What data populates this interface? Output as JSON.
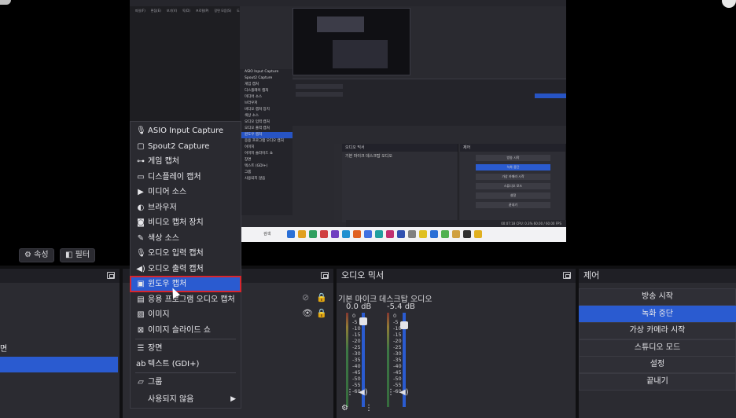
{
  "preview": {
    "menubar": [
      "파일(F)",
      "편집(E)",
      "보기(V)",
      "독(D)",
      "프로필(P)",
      "장면 모음(S)",
      "도구(T)",
      "도움말(H)"
    ],
    "inner_menu_items": [
      "ASIO Input Capture",
      "Spout2 Capture",
      "게임 캡처",
      "디스플레이 캡처",
      "미디어 소스",
      "브라우저",
      "비디오 캡처 장치",
      "색상 소스",
      "오디오 입력 캡처",
      "오디오 출력 캡처",
      "윈도우 캡처",
      "응용 프로그램 오디오 캡처",
      "이미지",
      "이미지 슬라이드 쇼",
      "장면",
      "텍스트 (GDI+)",
      "그룹",
      "사용되지 않음"
    ],
    "inner_mixer_title": "오디오 믹서",
    "inner_mixer_sources": "기본 마이크  데스크탑 오디오",
    "inner_controls_title": "제어",
    "inner_controls": [
      "방송 시작",
      "녹화 중단",
      "가상 카메라 시작",
      "스튜디오 모드",
      "설정",
      "끝내기"
    ],
    "status_text": "00:07:18   CPU: 0.3%   60.00 / 60.00 FPS",
    "taskbar_search": "검색"
  },
  "toolbar": {
    "properties_label": "속성",
    "filters_label": "필터"
  },
  "scenes": {
    "item_prefix": "면"
  },
  "mixer": {
    "title": "오디오 믹서",
    "channels": [
      {
        "name": "기본 마이크",
        "db": "0.0 dB",
        "level": 0.95
      },
      {
        "name": "데스크탑 오디오",
        "db": "-5.4 dB",
        "level": 0.9
      }
    ],
    "scale": [
      "0",
      "-5",
      "-10",
      "-15",
      "-20",
      "-25",
      "-30",
      "-35",
      "-40",
      "-45",
      "-50",
      "-55",
      "-60"
    ]
  },
  "controls": {
    "title": "제어",
    "buttons": [
      "방송 시작",
      "녹화 중단",
      "가상 카메라 시작",
      "스튜디오 모드",
      "설정",
      "끝내기"
    ],
    "active_index": 1
  },
  "context_menu": {
    "items": [
      {
        "icon": "🎙",
        "label": "ASIO Input Capture"
      },
      {
        "icon": "▢",
        "label": "Spout2 Capture"
      },
      {
        "icon": "⊶",
        "label": "게임 캡처"
      },
      {
        "icon": "▭",
        "label": "디스플레이 캡처"
      },
      {
        "icon": "▶",
        "label": "미디어 소스"
      },
      {
        "icon": "◐",
        "label": "브라우저"
      },
      {
        "icon": "◙",
        "label": "비디오 캡처 장치"
      },
      {
        "icon": "✎",
        "label": "색상 소스"
      },
      {
        "icon": "🎙",
        "label": "오디오 입력 캡처"
      },
      {
        "icon": "◀)",
        "label": "오디오 출력 캡처"
      },
      {
        "icon": "▣",
        "label": "윈도우 캡처"
      },
      {
        "icon": "▤",
        "label": "응용 프로그램 오디오 캡처"
      },
      {
        "icon": "▨",
        "label": "이미지"
      },
      {
        "icon": "⊠",
        "label": "이미지 슬라이드 쇼"
      },
      {
        "icon": "☰",
        "label": "장면"
      },
      {
        "icon": "ab",
        "label": "텍스트 (GDI+)"
      },
      {
        "icon": "▱",
        "label": "그룹"
      },
      {
        "icon": "",
        "label": "사용되지 않음"
      }
    ],
    "highlighted_index": 10,
    "submenu_chevron": "▶"
  },
  "colors": {
    "accent": "#2a5bd0",
    "highlight_outline": "#d8262e",
    "panel": "#2b2b31"
  }
}
